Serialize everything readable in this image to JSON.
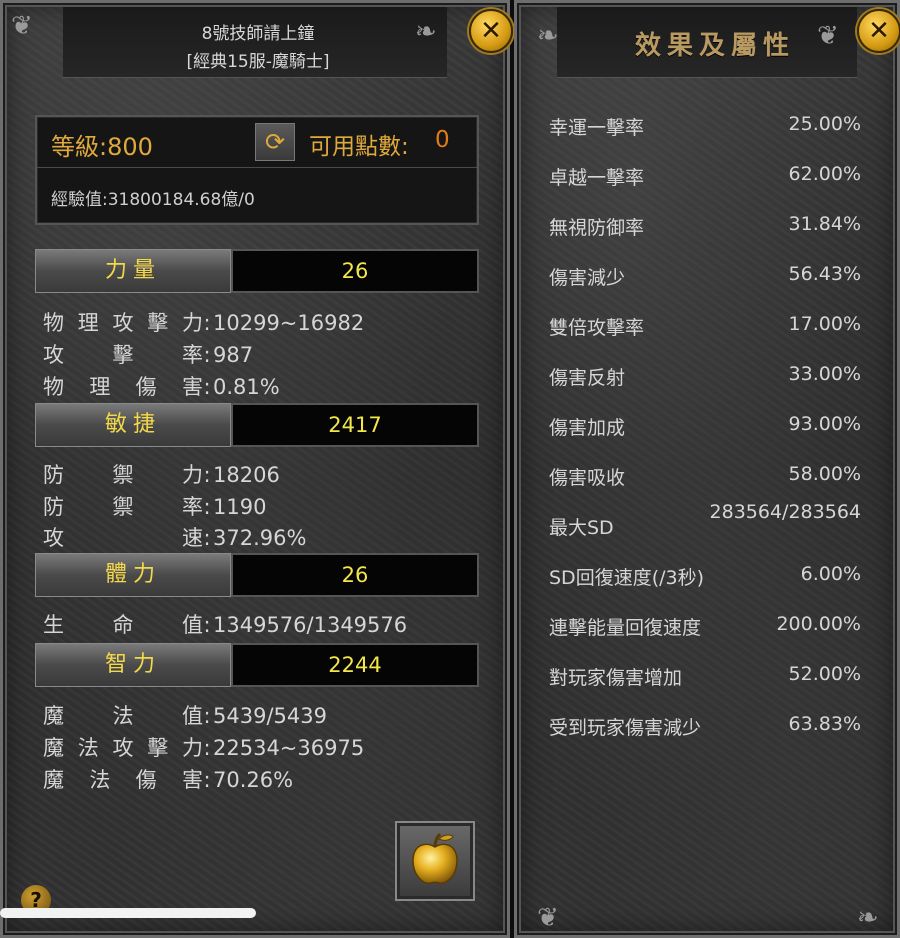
{
  "character": {
    "name": "8號技師請上鐘",
    "server": "[經典15服-魔騎士]",
    "level_label": "等級:800",
    "points_label": "可用點數:",
    "points_value": "0",
    "exp_label": "經驗值:31800184.68億/0"
  },
  "stats": [
    {
      "name": "力量",
      "value": "26",
      "attrs": [
        {
          "key": "物理攻擊力",
          "value": "10299~16982"
        },
        {
          "key": "攻擊率",
          "value": "987"
        },
        {
          "key": "物理傷害",
          "value": "0.81%"
        }
      ]
    },
    {
      "name": "敏捷",
      "value": "2417",
      "attrs": [
        {
          "key": "防禦力",
          "value": "18206"
        },
        {
          "key": "防禦率",
          "value": "1190"
        },
        {
          "key": "攻速",
          "value": "372.96%"
        }
      ]
    },
    {
      "name": "體力",
      "value": "26",
      "attrs": [
        {
          "key": "生命值",
          "value": "1349576/1349576"
        }
      ]
    },
    {
      "name": "智力",
      "value": "2244",
      "attrs": [
        {
          "key": "魔法值",
          "value": "5439/5439"
        },
        {
          "key": "魔法攻擊力",
          "value": "22534~36975"
        },
        {
          "key": "魔法傷害",
          "value": "70.26%"
        }
      ]
    }
  ],
  "attr_separator": ":",
  "effects": {
    "title": "效果及屬性",
    "items": [
      {
        "name": "幸運一擊率",
        "value": "25.00%"
      },
      {
        "name": "卓越一擊率",
        "value": "62.00%"
      },
      {
        "name": "無視防御率",
        "value": "31.84%"
      },
      {
        "name": "傷害減少",
        "value": "56.43%"
      },
      {
        "name": "雙倍攻擊率",
        "value": "17.00%"
      },
      {
        "name": "傷害反射",
        "value": "33.00%"
      },
      {
        "name": "傷害加成",
        "value": "93.00%"
      },
      {
        "name": "傷害吸收",
        "value": "58.00%"
      },
      {
        "name": "最大SD",
        "value": "283564/283564"
      },
      {
        "name": "SD回復速度(/3秒)",
        "value": "6.00%"
      },
      {
        "name": "連擊能量回復速度",
        "value": "200.00%"
      },
      {
        "name": "對玩家傷害增加",
        "value": "52.00%"
      },
      {
        "name": "受到玩家傷害減少",
        "value": "63.83%"
      }
    ]
  },
  "buttons": {
    "close_glyph": "✕",
    "help_glyph": "?",
    "refresh_glyph": "⟳"
  },
  "icons": {
    "apple": "golden-apple-icon"
  },
  "colors": {
    "gold_label": "#e0a93b",
    "stat_value": "#f2e64a",
    "panel_border": "#6e6e6e"
  }
}
